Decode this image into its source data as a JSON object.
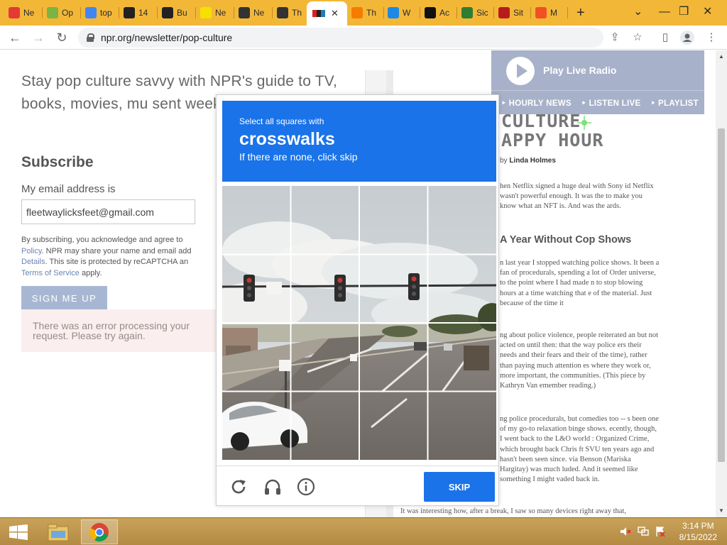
{
  "browser": {
    "tabs": [
      {
        "title": "Ne",
        "favicon": "red-arrow-icon",
        "color": "#e53935"
      },
      {
        "title": "Op",
        "favicon": "colorwheel-icon",
        "color": "#7cb342"
      },
      {
        "title": "top",
        "favicon": "google-icon",
        "color": "#4285f4"
      },
      {
        "title": "14",
        "favicon": "stack-icon",
        "color": "#222222"
      },
      {
        "title": "Bu",
        "favicon": "stack-icon",
        "color": "#222222"
      },
      {
        "title": "Ne",
        "favicon": "v-icon",
        "color": "#f5e000"
      },
      {
        "title": "Ne",
        "favicon": "mask-icon",
        "color": "#333333"
      },
      {
        "title": "Th",
        "favicon": "mask-icon",
        "color": "#333333"
      }
    ],
    "tabs_right": [
      {
        "title": "Th",
        "favicon": "orange-circle-icon",
        "color": "#f57c00"
      },
      {
        "title": "W",
        "favicon": "chart-icon",
        "color": "#1e88e5"
      },
      {
        "title": "Ac",
        "favicon": "dark-square-icon",
        "color": "#111111"
      },
      {
        "title": "Sic",
        "favicon": "green-face-icon",
        "color": "#2e7d32"
      },
      {
        "title": "Sit",
        "favicon": "v-red-icon",
        "color": "#b71c1c"
      },
      {
        "title": "M",
        "favicon": "microsoft-icon",
        "color": "#f25022"
      }
    ],
    "active_tab_close": "✕",
    "new_tab": "+",
    "url": "npr.org/newsletter/pop-culture"
  },
  "page": {
    "intro": "Stay pop culture savvy with NPR's guide to TV, books, movies, mu sent weekly.",
    "subscribe_heading": "Subscribe",
    "email_label": "My email address is",
    "email_value": "fleetwaylicksfeet@gmail.com",
    "legal_line1": "By subscribing, you acknowledge and agree to",
    "legal_policy": "Policy",
    "legal_line2": ". NPR may share your name and email add",
    "legal_details": "Details",
    "legal_line3": ". This site is protected by reCAPTCHA an",
    "legal_tos": "Terms of Service",
    "legal_line4": " apply.",
    "signup_button": "SIGN ME UP",
    "error_line1": "There was an error processing your",
    "error_line2": "request. Please try again."
  },
  "radio": {
    "play_label": "Play Live Radio",
    "links": [
      "HOURLY NEWS",
      "LISTEN LIVE",
      "PLAYLIST"
    ]
  },
  "article": {
    "logo_line1": "CULTURE",
    "logo_line2": "APPY HOUR",
    "byline_prefix": "by ",
    "byline_author": "Linda Holmes",
    "p1": "hen Netflix signed a huge deal with Sony id Netflix wasn't powerful enough. It was the to make you know what an NFT is. And was the ards.",
    "heading": "A Year Without Cop Shows",
    "p2": "n last year I stopped watching police shows. It been a fan of procedurals, spending a lot of Order universe, to the point where I had made n to stop blowing hours at a time watching that e of the material. Just because of the time it",
    "p3": "ng about police violence, people reiterated an but not acted on until then: that the way police ers their needs and their fears and their of the time), rather than paying much attention es where they work or, more important, the communities. (This piece by Kathryn Van emember reading.)",
    "p4": "ng police procedurals, but comedies too -- s been one of my go-to relaxation binge shows. ecently, though, I went back to the L&O world : Organized Crime, which brought back Chris ft SVU ten years ago and hasn't been seen since. via Benson (Mariska Hargitay) was much luded. And it seemed like something I might vaded back in.",
    "p5": "It was interesting how, after a break, I saw so many devices right away that,"
  },
  "captcha": {
    "instruction_small": "Select all squares with",
    "target": "crosswalks",
    "instruction_sub": "If there are none, click skip",
    "skip_button": "SKIP",
    "grid_size": 4,
    "tiles": [
      "1",
      "2",
      "3",
      "4",
      "5",
      "6",
      "7",
      "8",
      "9",
      "10",
      "11",
      "12",
      "13",
      "14",
      "15",
      "16"
    ]
  },
  "taskbar": {
    "time": "3:14 PM",
    "date": "8/15/2022"
  },
  "colors": {
    "tabstrip": "#f3b738",
    "captcha_blue": "#1a73e8",
    "radio_box": "#a7b1c9"
  }
}
